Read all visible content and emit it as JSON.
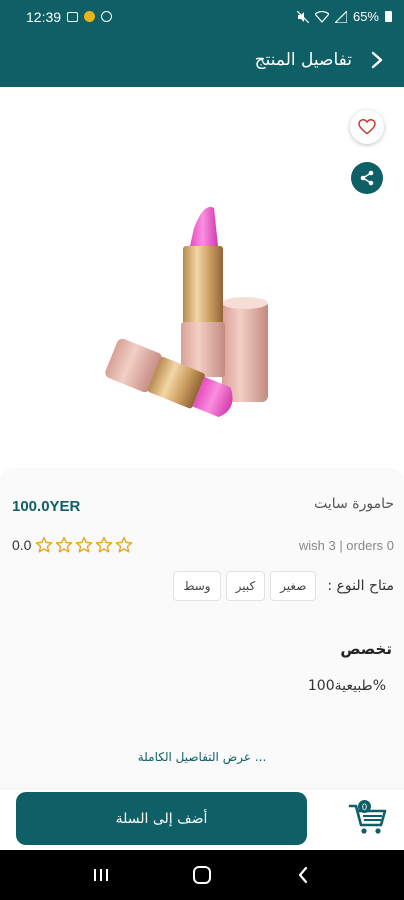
{
  "status_bar": {
    "time": "12:39",
    "battery": "65%"
  },
  "app_bar": {
    "title": "تفاصيل المنتج"
  },
  "product": {
    "name": "حامورة سايت",
    "price": "100.0YER",
    "rating": "0.0",
    "stats": "wish 3 | orders 0",
    "types_label": "متاح النوع :",
    "types": [
      "صغير",
      "كبير",
      "وسط"
    ],
    "section_title": "تخصص",
    "section_body": "طبيعية100%",
    "full_details_link": "عرض التفاصيل الكاملة ..."
  },
  "bottom": {
    "add_to_cart_label": "أضف إلى السلة",
    "cart_count": "0"
  },
  "colors": {
    "brand": "#0e5f66",
    "star": "#e8a317",
    "heart": "#c0392b"
  },
  "icons": {
    "back": "chevron-right-icon",
    "favorite": "heart-icon",
    "share": "share-icon",
    "cart": "cart-icon",
    "star": "star-outline-icon"
  }
}
